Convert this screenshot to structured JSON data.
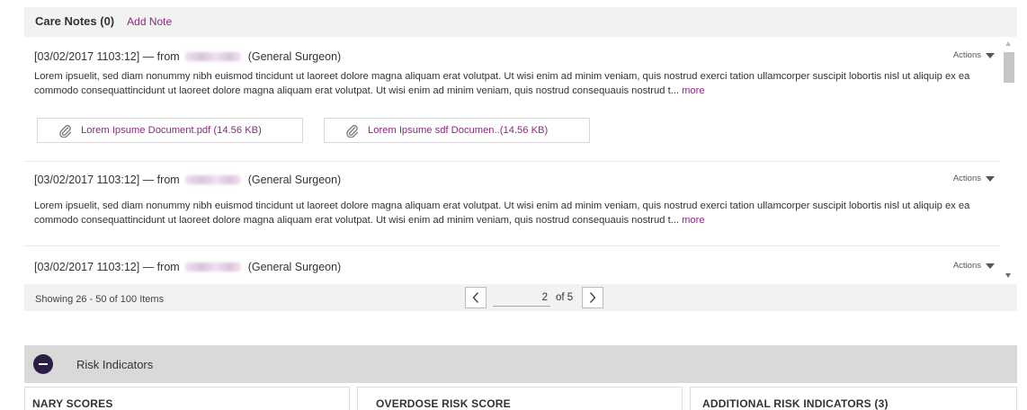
{
  "care_notes": {
    "title": "Care Notes (0)",
    "add_label": "Add Note",
    "notes": [
      {
        "timestamp": "[03/02/2017 1103:12] — from",
        "role": "(General Surgeon)",
        "actions_label": "Actions",
        "text": "Lorem ipsuelit, sed diam nonummy nibh euismod tincidunt ut laoreet dolore magna aliquam erat volutpat. Ut wisi enim ad minim veniam, quis nostrud exerci tation ullamcorper suscipit lobortis nisl ut aliquip ex ea commodo consequattincidunt ut laoreet dolore magna aliquam erat volutpat. Ut wisi enim ad minim veniam, quis nostrud consequauis nostrud t...",
        "more_label": "more",
        "attachments": [
          "Lorem Ipsume Document.pdf (14.56 KB)",
          "Lorem Ipsume sdf Documen..(14.56 KB)"
        ]
      },
      {
        "timestamp": "[03/02/2017 1103:12] — from",
        "role": "(General Surgeon)",
        "actions_label": "Actions",
        "text": "Lorem ipsuelit, sed diam nonummy nibh euismod tincidunt ut laoreet dolore magna aliquam erat volutpat. Ut wisi enim ad minim veniam, quis nostrud exerci tation ullamcorper suscipit lobortis nisl ut aliquip ex ea commodo consequattincidunt ut laoreet dolore magna aliquam erat volutpat. Ut wisi enim ad minim veniam, quis nostrud consequauis nostrud t...",
        "more_label": "more"
      },
      {
        "timestamp": "[03/02/2017 1103:12] — from",
        "role": "(General Surgeon)",
        "actions_label": "Actions"
      }
    ],
    "pagination": {
      "showing": "Showing 26 - 50 of 100 Items",
      "page": "2",
      "of_label": "of 5"
    }
  },
  "risk": {
    "title": "Risk Indicators",
    "cards": [
      "NARY SCORES",
      "OVERDOSE RISK SCORE",
      "ADDITIONAL RISK INDICATORS (3)"
    ]
  },
  "colors": {
    "accent": "#8a2a7e",
    "toggle": "#2a1e44",
    "panel_bg": "#f2f2f2",
    "risk_bar_bg": "#d9d9d9"
  },
  "icons": [
    "paperclip-icon",
    "caret-down-icon",
    "chevron-left-icon",
    "chevron-right-icon",
    "minus-circle-icon"
  ]
}
